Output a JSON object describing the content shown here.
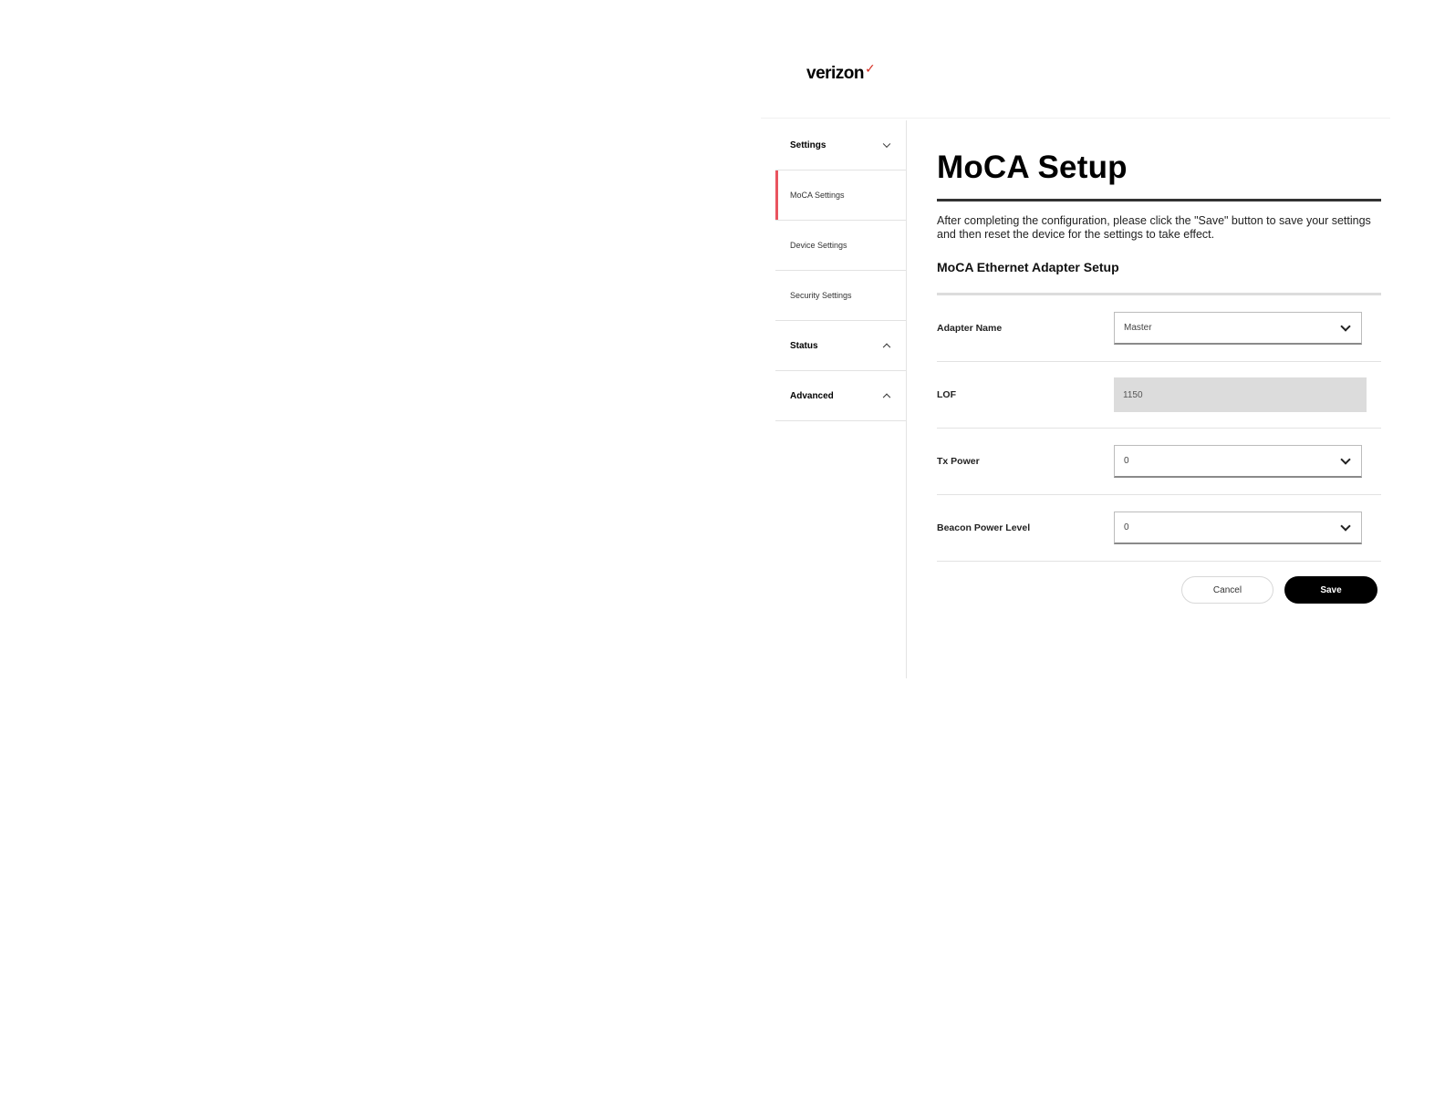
{
  "brand": {
    "name": "verizon",
    "check_mark": "✓"
  },
  "sidebar": {
    "items": [
      {
        "label": "Settings"
      },
      {
        "label": "MoCA Settings"
      },
      {
        "label": "Device Settings"
      },
      {
        "label": "Security Settings"
      },
      {
        "label": "Status"
      },
      {
        "label": "Advanced"
      }
    ]
  },
  "main": {
    "title": "MoCA Setup",
    "description": "After completing the configuration, please click the \"Save\" button to save your settings and then reset the device for the settings to take effect.",
    "section_title": "MoCA Ethernet Adapter Setup",
    "fields": {
      "adapter_name": {
        "label": "Adapter Name",
        "value": "Master"
      },
      "lof": {
        "label": "LOF",
        "value": "1150"
      },
      "tx_power": {
        "label": "Tx Power",
        "value": "0"
      },
      "beacon_power_level": {
        "label": "Beacon Power Level",
        "value": "0"
      }
    },
    "buttons": {
      "cancel": "Cancel",
      "save": "Save"
    }
  },
  "colors": {
    "accent_active": "#e9545f",
    "brand_check": "#d52b1e",
    "primary_button": "#000000",
    "readonly_field": "#dcdcdc"
  }
}
